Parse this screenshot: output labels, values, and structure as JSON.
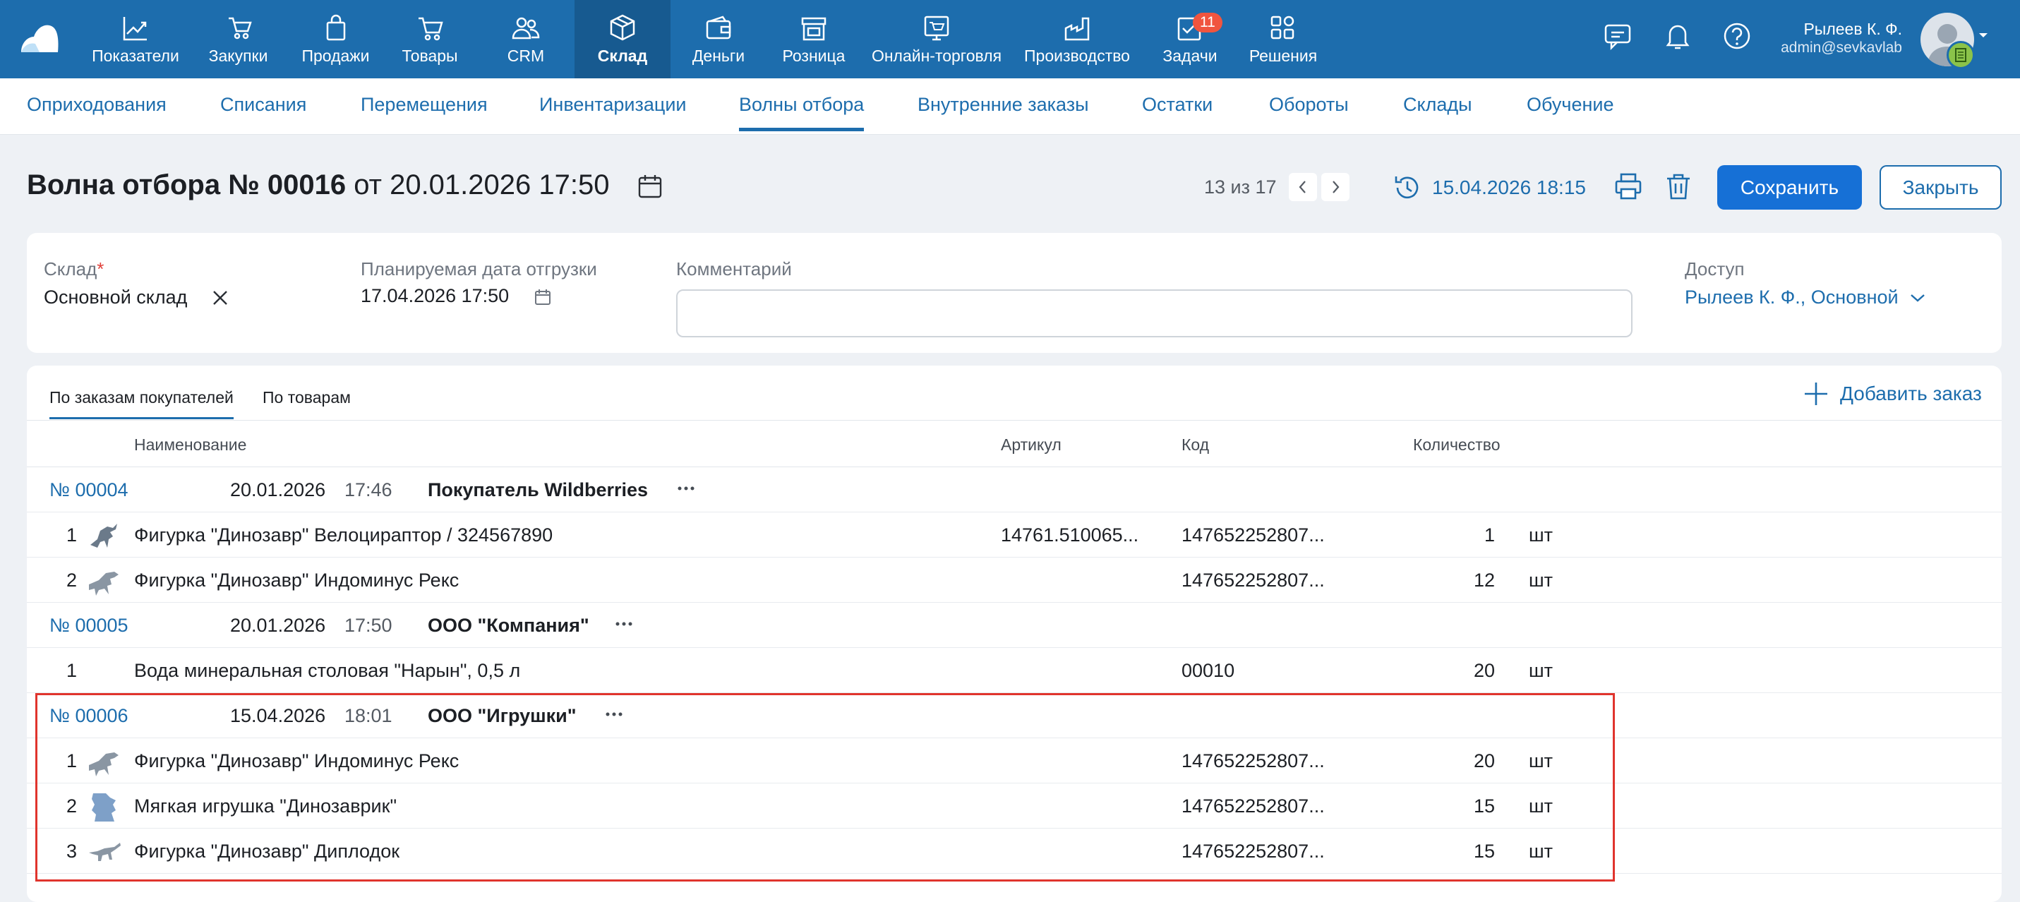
{
  "nav": {
    "items": [
      {
        "label": "Показатели",
        "icon": "chart-line-icon"
      },
      {
        "label": "Закупки",
        "icon": "cart-hand-icon"
      },
      {
        "label": "Продажи",
        "icon": "bag-icon"
      },
      {
        "label": "Товары",
        "icon": "cart-icon"
      },
      {
        "label": "CRM",
        "icon": "users-icon"
      },
      {
        "label": "Склад",
        "icon": "box-icon"
      },
      {
        "label": "Деньги",
        "icon": "wallet-icon"
      },
      {
        "label": "Розница",
        "icon": "store-icon"
      },
      {
        "label": "Онлайн-торговля",
        "icon": "online-store-icon"
      },
      {
        "label": "Производство",
        "icon": "factory-icon"
      },
      {
        "label": "Задачи",
        "icon": "tasks-icon"
      },
      {
        "label": "Решения",
        "icon": "grid-icon"
      }
    ],
    "active": "Склад",
    "tasks_badge": "11",
    "user_name": "Рылеев К. Ф.",
    "user_email": "admin@sevkavlab"
  },
  "subnav": {
    "items": [
      "Оприходования",
      "Списания",
      "Перемещения",
      "Инвентаризации",
      "Волны отбора",
      "Внутренние заказы",
      "Остатки",
      "Обороты",
      "Склады",
      "Обучение"
    ],
    "active": "Волны отбора"
  },
  "header": {
    "title_bold": "Волна отбора № 00016",
    "title_rest": " от 20.01.2026 17:50",
    "pager": "13 из 17",
    "history_date": "15.04.2026 18:15",
    "save_label": "Сохранить",
    "close_label": "Закрыть"
  },
  "form": {
    "warehouse_label": "Склад",
    "warehouse_required": "*",
    "warehouse_value": "Основной склад",
    "ship_date_label": "Планируемая дата отгрузки",
    "ship_date_value": "17.04.2026 17:50",
    "comment_label": "Комментарий",
    "comment_value": "",
    "access_label": "Доступ",
    "access_value": "Рылеев К. Ф., Основной"
  },
  "table": {
    "tabs": [
      "По заказам покупателей",
      "По товарам"
    ],
    "active_tab": "По заказам покупателей",
    "add_order_label": "Добавить заказ",
    "columns": {
      "name": "Наименование",
      "sku": "Артикул",
      "code": "Код",
      "qty": "Количество"
    },
    "orders": [
      {
        "number": "№ 00004",
        "date": "20.01.2026",
        "time": "17:46",
        "buyer": "Покупатель Wildberries",
        "items": [
          {
            "n": "1",
            "name": "Фигурка \"Динозавр\" Велоцираптор / 324567890",
            "sku": "14761.510065...",
            "code": "147652252807...",
            "qty": "1",
            "unit": "шт",
            "thumb": "velociraptor"
          },
          {
            "n": "2",
            "name": "Фигурка \"Динозавр\" Индоминус Рекс",
            "sku": "",
            "code": "147652252807...",
            "qty": "12",
            "unit": "шт",
            "thumb": "indominus"
          }
        ]
      },
      {
        "number": "№ 00005",
        "date": "20.01.2026",
        "time": "17:50",
        "buyer": "ООО \"Компания\"",
        "items": [
          {
            "n": "1",
            "name": "Вода минеральная столовая \"Нарын\", 0,5 л",
            "sku": "",
            "code": "00010",
            "qty": "20",
            "unit": "шт",
            "thumb": ""
          }
        ]
      },
      {
        "number": "№ 00006",
        "date": "15.04.2026",
        "time": "18:01",
        "buyer": "ООО \"Игрушки\"",
        "items": [
          {
            "n": "1",
            "name": "Фигурка \"Динозавр\" Индоминус Рекс",
            "sku": "",
            "code": "147652252807...",
            "qty": "20",
            "unit": "шт",
            "thumb": "indominus"
          },
          {
            "n": "2",
            "name": "Мягкая игрушка \"Динозаврик\"",
            "sku": "",
            "code": "147652252807...",
            "qty": "15",
            "unit": "шт",
            "thumb": "plush"
          },
          {
            "n": "3",
            "name": "Фигурка \"Динозавр\" Диплодок",
            "sku": "",
            "code": "147652252807...",
            "qty": "15",
            "unit": "шт",
            "thumb": "diplodocus"
          }
        ]
      }
    ]
  },
  "colors": {
    "brand": "#1d6dad",
    "primary_button": "#1670d6",
    "highlight_border": "#e0342d",
    "badge": "#f0553f"
  }
}
